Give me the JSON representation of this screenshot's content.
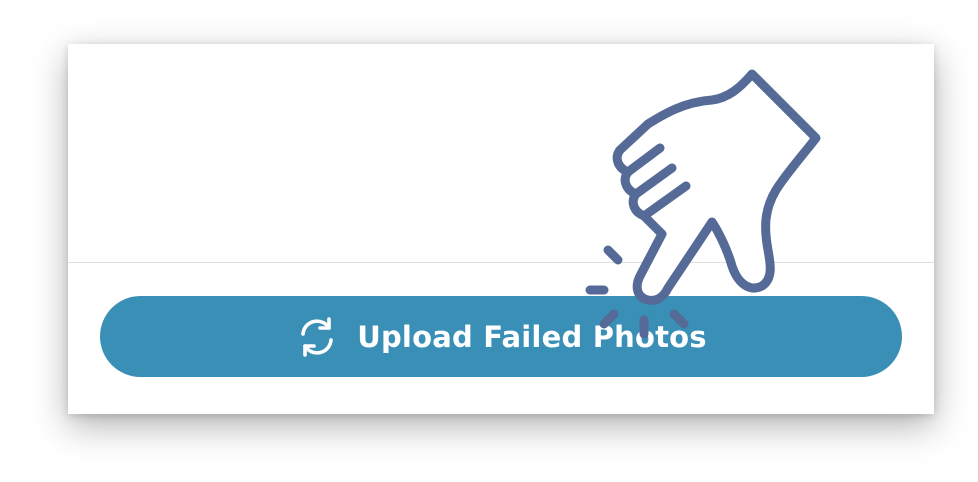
{
  "upload_button": {
    "label": "Upload Failed Photos",
    "icon": "refresh-icon"
  },
  "cursor": {
    "icon": "pointing-hand-icon"
  },
  "colors": {
    "button_background": "#3a8fb7",
    "button_text": "#ffffff",
    "hand_stroke": "#556a97",
    "divider": "#dedede"
  }
}
